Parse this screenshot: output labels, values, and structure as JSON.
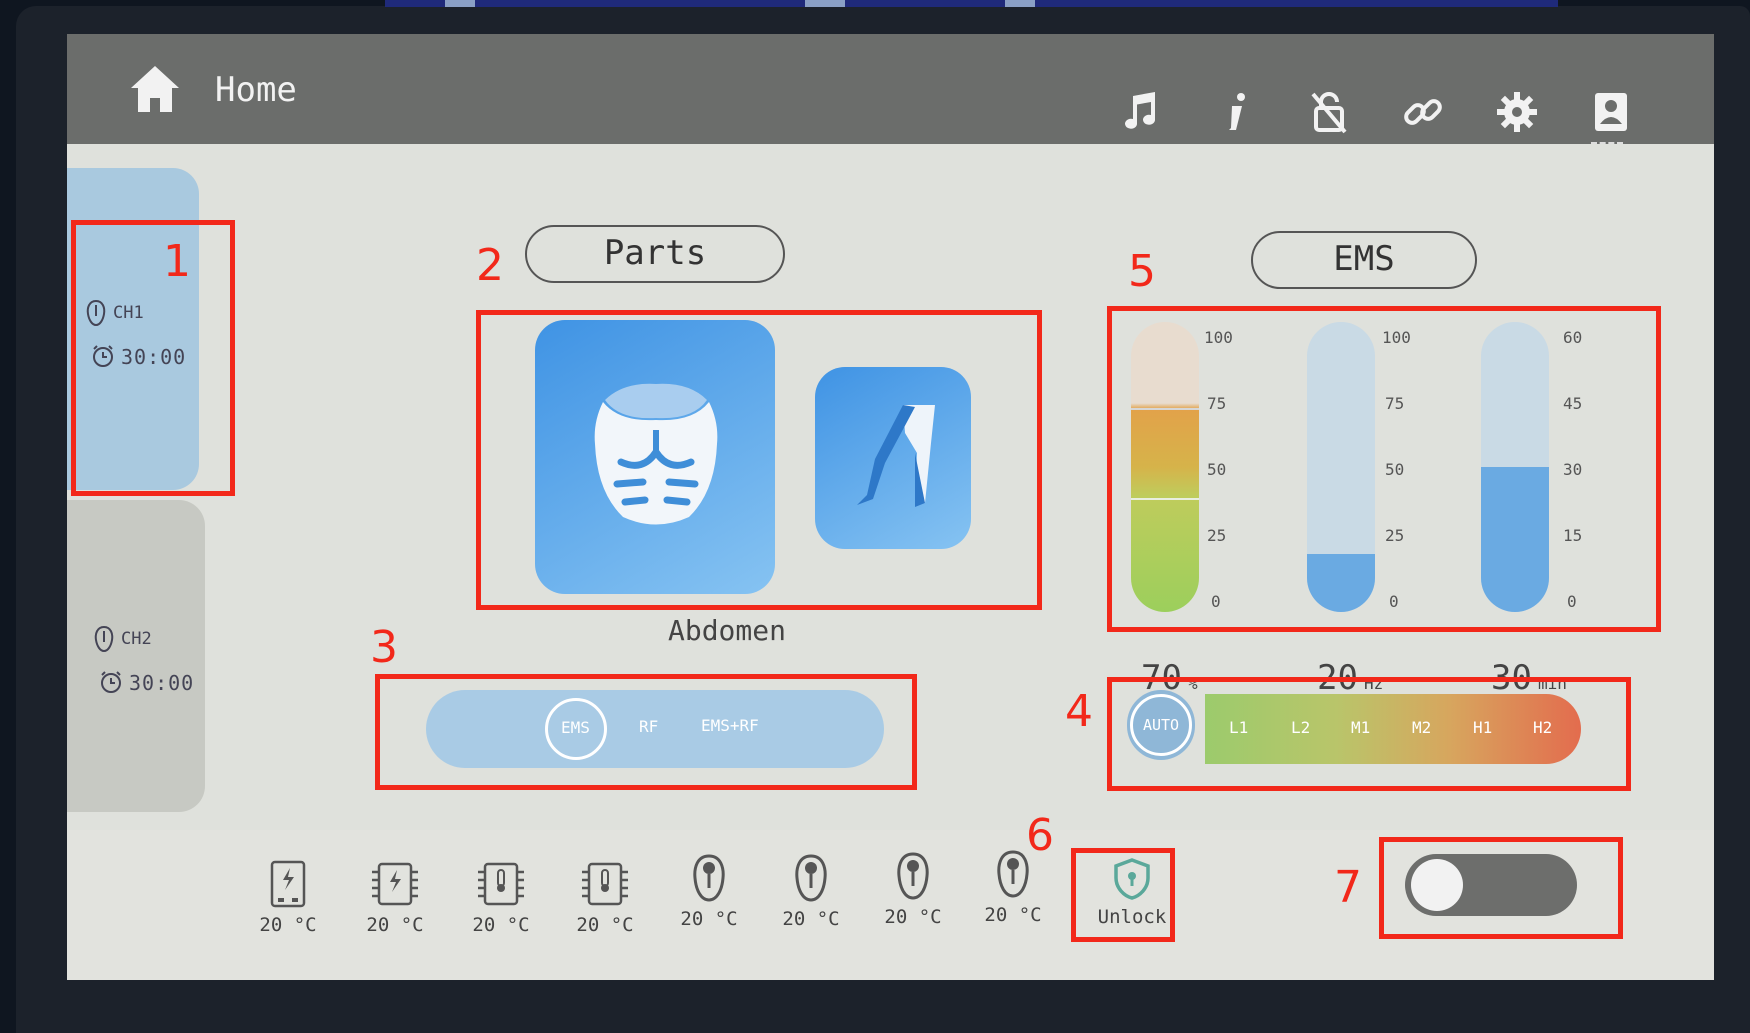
{
  "header": {
    "title": "Home"
  },
  "channels": [
    {
      "name": "CH1",
      "time": "30:00"
    },
    {
      "name": "CH2",
      "time": "30:00"
    }
  ],
  "parts": {
    "title": "Parts",
    "selected_label": "Abdomen"
  },
  "modes": {
    "items": [
      "EMS",
      "RF",
      "EMS+RF"
    ],
    "selected": "EMS"
  },
  "ems": {
    "title": "EMS",
    "gauges": [
      {
        "value": "70",
        "unit": "%",
        "ticks": [
          "100",
          "75",
          "50",
          "25",
          "0"
        ],
        "max": 100,
        "level": 70
      },
      {
        "value": "20",
        "unit": "Hz",
        "ticks": [
          "100",
          "75",
          "50",
          "25",
          "0"
        ],
        "max": 100,
        "level": 20
      },
      {
        "value": "30",
        "unit": "min",
        "ticks": [
          "60",
          "45",
          "30",
          "15",
          "0"
        ],
        "max": 60,
        "level": 30
      }
    ]
  },
  "levels": {
    "auto": "AUTO",
    "items": [
      "L1",
      "L2",
      "M1",
      "M2",
      "H1",
      "H2"
    ]
  },
  "temperatures": [
    "20 °C",
    "20 °C",
    "20 °C",
    "20 °C",
    "20 °C",
    "20 °C",
    "20 °C",
    "20 °C"
  ],
  "unlock": {
    "label": "Unlock"
  },
  "annotations": [
    "1",
    "2",
    "3",
    "4",
    "5",
    "6",
    "7"
  ]
}
